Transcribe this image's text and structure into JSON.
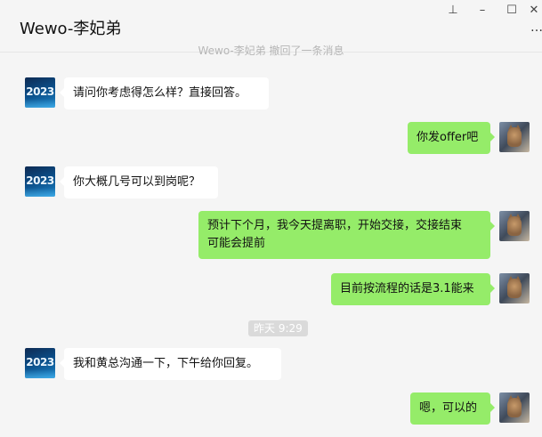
{
  "window": {
    "title": "Wewo-李妃弟",
    "controls": {
      "pin_icon": "pin-icon",
      "minimize_icon": "minimize-icon",
      "maximize_icon": "maximize-icon",
      "close_icon": "close-icon",
      "more_icon": "more-icon"
    },
    "pin_glyph": "⊥",
    "minimize_glyph": "–",
    "maximize_glyph": "☐",
    "close_glyph": "✕",
    "more_glyph": "…"
  },
  "recall_notice": "Wewo-李妃弟 撤回了一条消息",
  "avatars": {
    "contact_text": "2023",
    "contact_icon": "avatar-2023-icon",
    "self_icon": "avatar-cat-icon"
  },
  "messages": [
    {
      "side": "in",
      "text": "请问你考虑得怎么样？直接回答。"
    },
    {
      "side": "out",
      "text": "你发offer吧"
    },
    {
      "side": "in",
      "text": "你大概几号可以到岗呢？"
    },
    {
      "side": "out",
      "text_line1": "预计下个月，我今天提离职，开始交接，交接结束",
      "text_line2": "可能会提前"
    },
    {
      "side": "out",
      "text": "目前按流程的话是3.1能来"
    },
    {
      "side": "in",
      "text": "我和黄总沟通一下，下午给你回复。"
    },
    {
      "side": "out",
      "text": "嗯，可以的"
    }
  ],
  "timestamp": "昨天 9:29",
  "colors": {
    "bubble_out": "#95ec69",
    "bubble_in": "#ffffff",
    "background": "#f5f5f5",
    "timestamp_bg": "#dadada"
  }
}
